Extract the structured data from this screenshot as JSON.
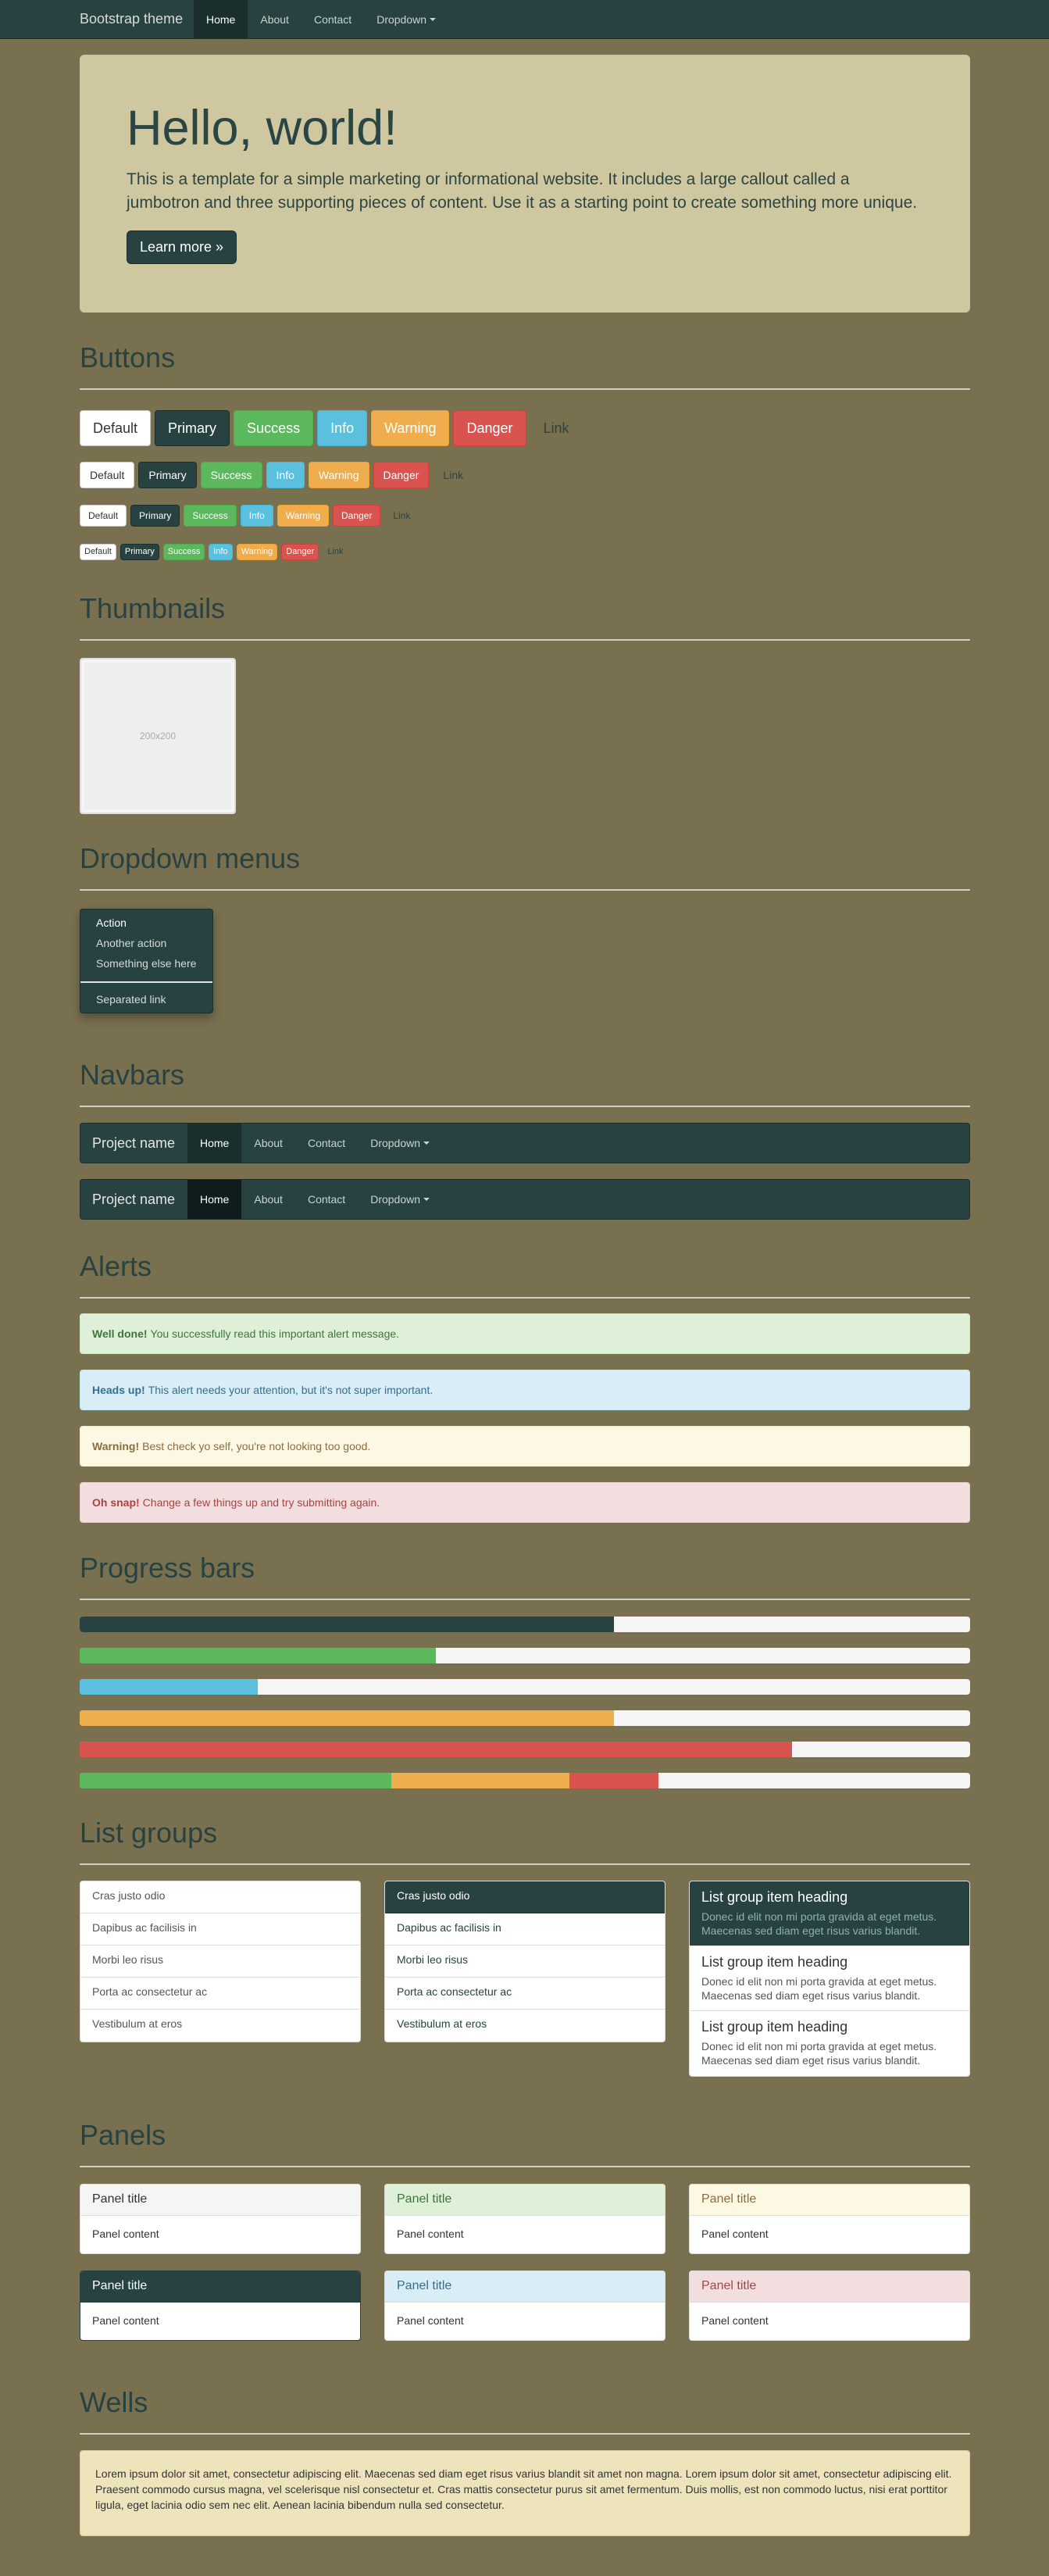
{
  "navbar": {
    "brand": "Bootstrap theme",
    "items": [
      {
        "label": "Home",
        "active": true
      },
      {
        "label": "About"
      },
      {
        "label": "Contact"
      },
      {
        "label": "Dropdown"
      }
    ]
  },
  "jumbotron": {
    "heading": "Hello, world!",
    "text": "This is a template for a simple marketing or informational website. It includes a large callout called a jumbotron and three supporting pieces of content. Use it as a starting point to create something more unique.",
    "button": "Learn more »"
  },
  "sections": {
    "buttons": "Buttons",
    "thumbnails": "Thumbnails",
    "dropdowns": "Dropdown menus",
    "navbars": "Navbars",
    "alerts": "Alerts",
    "progress": "Progress bars",
    "listgroups": "List groups",
    "panels": "Panels",
    "wells": "Wells"
  },
  "buttons": {
    "default": "Default",
    "primary": "Primary",
    "success": "Success",
    "info": "Info",
    "warning": "Warning",
    "danger": "Danger",
    "link": "Link"
  },
  "thumbnail": {
    "label": "200x200"
  },
  "dropdown": {
    "items": [
      "Action",
      "Another action",
      "Something else here"
    ],
    "separated": "Separated link"
  },
  "navbar_demo": {
    "brand": "Project name",
    "items": [
      "Home",
      "About",
      "Contact",
      "Dropdown"
    ]
  },
  "alerts": [
    {
      "strong": "Well done!",
      "text": "You successfully read this important alert message."
    },
    {
      "strong": "Heads up!",
      "text": "This alert needs your attention, but it's not super important."
    },
    {
      "strong": "Warning!",
      "text": "Best check yo self, you're not looking too good."
    },
    {
      "strong": "Oh snap!",
      "text": "Change a few things up and try submitting again."
    }
  ],
  "progress": [
    {
      "value": 0.6,
      "color": "#284242"
    },
    {
      "value": 0.4,
      "color": "#5cb85c"
    },
    {
      "value": 0.2,
      "color": "#5bc0de"
    },
    {
      "value": 0.6,
      "color": "#f0ad4e"
    },
    {
      "value": 0.8,
      "color": "#d9534f"
    },
    {
      "stacked": [
        {
          "value": 0.35,
          "color": "#5cb85c"
        },
        {
          "value": 0.2,
          "color": "#f0ad4e"
        },
        {
          "value": 0.1,
          "color": "#d9534f"
        }
      ]
    }
  ],
  "list_groups": {
    "simple": [
      "Cras justo odio",
      "Dapibus ac facilisis in",
      "Morbi leo risus",
      "Porta ac consectetur ac",
      "Vestibulum at eros"
    ],
    "heading": "List group item heading",
    "body": "Donec id elit non mi porta gravida at eget metus. Maecenas sed diam eget risus varius blandit."
  },
  "panels": {
    "title": "Panel title",
    "content": "Panel content"
  },
  "well": {
    "text": "Lorem ipsum dolor sit amet, consectetur adipiscing elit. Maecenas sed diam eget risus varius blandit sit amet non magna. Lorem ipsum dolor sit amet, consectetur adipiscing elit. Praesent commodo cursus magna, vel scelerisque nisl consectetur et. Cras mattis consectetur purus sit amet fermentum. Duis mollis, est non commodo luctus, nisi erat porttitor ligula, eget lacinia odio sem nec elit. Aenean lacinia bibendum nulla sed consectetur."
  },
  "colors": {
    "background": "#79704f",
    "primary": "#284242",
    "jumbotron": "#cfc79f",
    "well": "#ede4bb"
  }
}
